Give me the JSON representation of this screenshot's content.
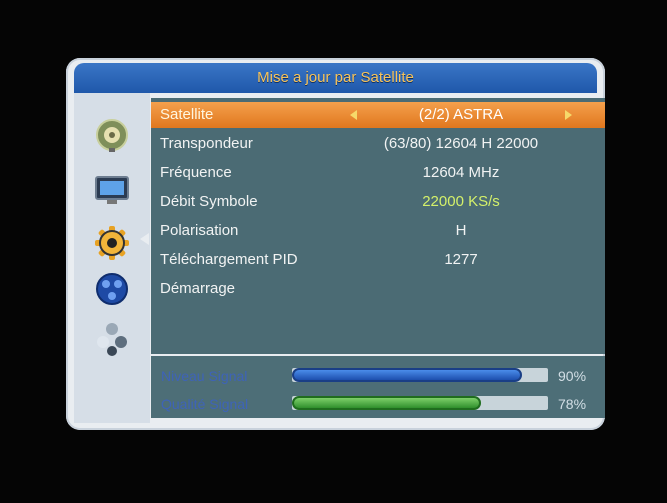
{
  "title": "Mise a jour par Satellite",
  "sidebar": {
    "icons": [
      "satellite-dish-icon",
      "tv-icon",
      "gear-icon",
      "globe-icon",
      "apps-icon"
    ],
    "active_index": 2
  },
  "rows": [
    {
      "label": "Satellite",
      "value": "(2/2) ASTRA",
      "selected": true
    },
    {
      "label": "Transpondeur",
      "value": "(63/80) 12604 H 22000"
    },
    {
      "label": "Fréquence",
      "value": "12604 MHz"
    },
    {
      "label": "Débit Symbole",
      "value": "22000 KS/s"
    },
    {
      "label": "Polarisation",
      "value": "H"
    },
    {
      "label": "Téléchargement PID",
      "value": "1277"
    },
    {
      "label": "Démarrage",
      "value": ""
    }
  ],
  "signal": {
    "level_label": "Niveau Signal",
    "level_pct": "90%",
    "level_value": 0.9,
    "quality_label": "Qualité Signal",
    "quality_pct": "78%",
    "quality_value": 0.74
  },
  "colors": {
    "title_text": "#f7c35a",
    "selected_row": "#ee8a2e",
    "content_bg": "#4b6b74"
  }
}
